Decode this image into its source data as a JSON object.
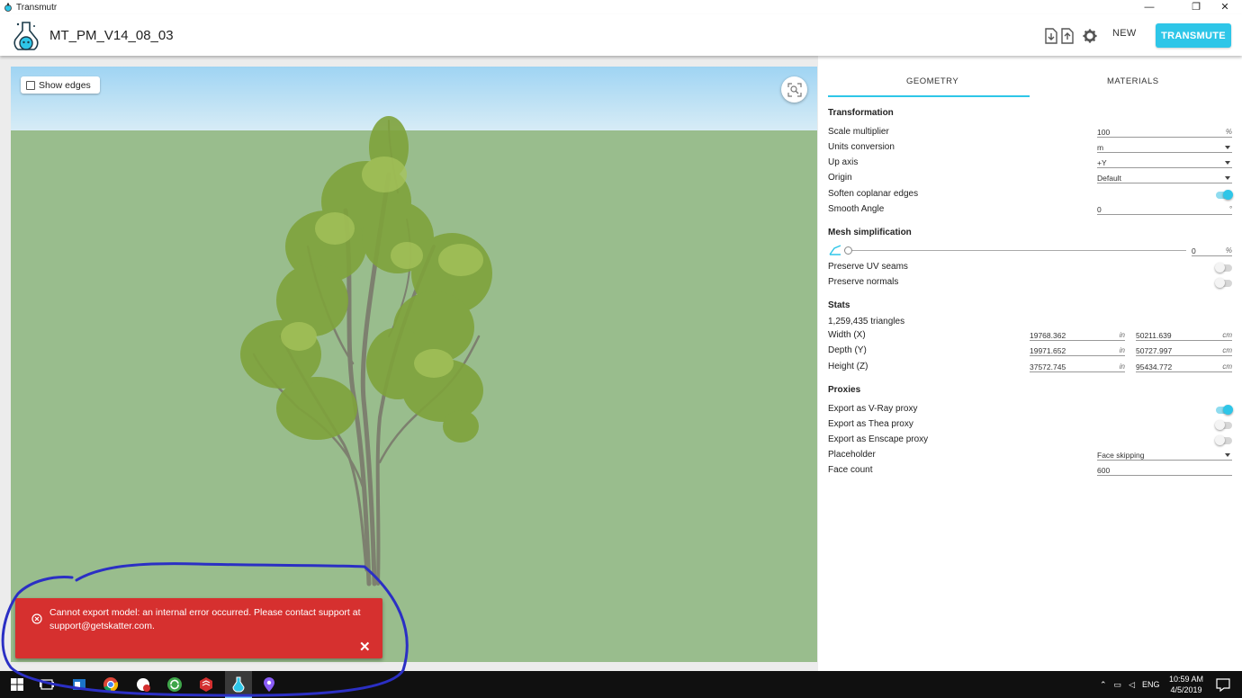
{
  "window": {
    "title": "Transmutr",
    "minimize": "—",
    "restore": "❐",
    "close": "✕"
  },
  "header": {
    "project_name": "MT_PM_V14_08_03",
    "new_label": "NEW",
    "transmute_label": "TRANSMUTE",
    "icons": [
      "import-file-icon",
      "export-file-icon",
      "gear-icon"
    ]
  },
  "viewport": {
    "show_edges_label": "Show edges",
    "show_edges_checked": false,
    "sky_color": "#b8e0f5",
    "ground_color": "#99bd8d"
  },
  "error": {
    "message": "Cannot export model: an internal error occurred. Please contact support at support@getskatter.com.",
    "close_symbol": "✕",
    "color": "#d6302f"
  },
  "panel": {
    "tabs": [
      {
        "label": "GEOMETRY",
        "active": true
      },
      {
        "label": "MATERIALS",
        "active": false
      }
    ],
    "transformation": {
      "title": "Transformation",
      "scale_label": "Scale multiplier",
      "scale_value": "100",
      "scale_unit": "%",
      "units_label": "Units conversion",
      "units_value": "m",
      "up_axis_label": "Up axis",
      "up_axis_value": "+Y",
      "origin_label": "Origin",
      "origin_value": "Default",
      "soften_label": "Soften coplanar edges",
      "soften_on": true,
      "smooth_label": "Smooth Angle",
      "smooth_value": "0",
      "smooth_unit": "°"
    },
    "mesh": {
      "title": "Mesh simplification",
      "value": "0",
      "unit": "%",
      "uv_label": "Preserve UV seams",
      "uv_on": false,
      "normals_label": "Preserve normals",
      "normals_on": false
    },
    "stats": {
      "title": "Stats",
      "triangles": "1,259,435 triangles",
      "width_label": "Width (X)",
      "width_in": "19768.362",
      "width_cm": "50211.639",
      "depth_label": "Depth (Y)",
      "depth_in": "19971.652",
      "depth_cm": "50727.997",
      "height_label": "Height (Z)",
      "height_in": "37572.745",
      "height_cm": "95434.772",
      "unit_in": "in",
      "unit_cm": "cm"
    },
    "proxies": {
      "title": "Proxies",
      "vray_label": "Export as V-Ray proxy",
      "vray_on": true,
      "thea_label": "Export as Thea proxy",
      "thea_on": false,
      "enscape_label": "Export as Enscape proxy",
      "enscape_on": false,
      "placeholder_label": "Placeholder",
      "placeholder_value": "Face skipping",
      "face_count_label": "Face count",
      "face_count_value": "600"
    }
  },
  "taskbar": {
    "language": "ENG",
    "time": "10:59 AM",
    "date": "4/5/2019",
    "icons": [
      "windows-start-icon",
      "task-view-icon",
      "outlook-icon",
      "chrome-icon",
      "app-badge-icon",
      "sync-icon",
      "sketchup-icon",
      "transmutr-icon",
      "maps-icon"
    ]
  },
  "accent_color": "#2ec6e8"
}
